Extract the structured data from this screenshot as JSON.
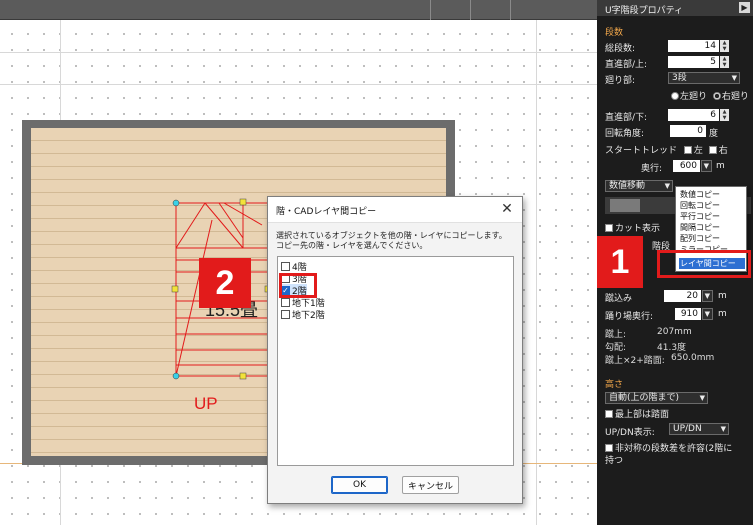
{
  "dialog": {
    "title": "階・CADレイヤ間コピー",
    "desc_line1": "選択されているオブジェクトを他の階・レイヤにコピーします。",
    "desc_line2": "コピー先の階・レイヤを選んでください。",
    "floors": [
      {
        "label": "4階",
        "checked": false
      },
      {
        "label": "3階",
        "checked": false
      },
      {
        "label": "2階",
        "checked": true
      },
      {
        "label": "地下1階",
        "checked": false
      },
      {
        "label": "地下2階",
        "checked": false
      }
    ],
    "ok_label": "OK",
    "cancel_label": "キャンセル",
    "close_glyph": "✕"
  },
  "canvas": {
    "up_label": "UP",
    "area_label": "15.5畳"
  },
  "markers": {
    "one": "1",
    "two": "2"
  },
  "panel": {
    "title": "U字階段プロパティ",
    "section_steps": "段数",
    "total_steps_label": "総段数:",
    "total_steps_value": "14",
    "straight_upper_label": "直進部/上:",
    "straight_upper_value": "5",
    "turn_label": "廻り部:",
    "turn_value": "3段",
    "left_turn_label": "左廻り",
    "right_turn_label": "右廻り",
    "straight_lower_label": "直進部/下:",
    "straight_lower_value": "6",
    "rotation_label": "回転角度:",
    "rotation_value": "0",
    "rotation_unit": "度",
    "start_tread_label": "スタートトレッド",
    "start_left": "左",
    "start_right": "右",
    "depth_label": "奥行:",
    "depth_value": "600",
    "depth_unit": "m",
    "copy_mode_value": "数値移動",
    "cut_display_label": "カット表示",
    "partial_label": "階段",
    "kerikomi_label": "蹴込み",
    "kerikomi_value": "20",
    "kerikomi_unit": "m",
    "landing_label": "踊り場奥行:",
    "landing_value": "910",
    "landing_unit": "m",
    "rise_label": "蹴上:",
    "rise_value": "207mm",
    "slope_label": "勾配:",
    "slope_value": "41.3度",
    "rise_tread_label": "蹴上×2+踏面:",
    "rise_tread_value": "650.0mm",
    "section_height": "高さ",
    "height_mode_value": "自動(上の階まで)",
    "top_floor_label": "最上部は踏面",
    "updn_label": "UP/DN表示:",
    "updn_value": "UP/DN",
    "nonuniform_label_1": "非対称の段数差を許容(2階に",
    "nonuniform_label_2": "持つ"
  },
  "popup_menu": {
    "items": [
      "数値コピー",
      "回転コピー",
      "平行コピー",
      "間隔コピー",
      "配列コピー",
      "ミラーコピー",
      "レイヤ間コピー"
    ],
    "selected_index": 6
  },
  "colors": {
    "accent_red": "#e21b1b",
    "section_orange": "#f0a64a",
    "floor_wood": "#e9d3b4",
    "selection_blue": "#2d6fd2"
  }
}
